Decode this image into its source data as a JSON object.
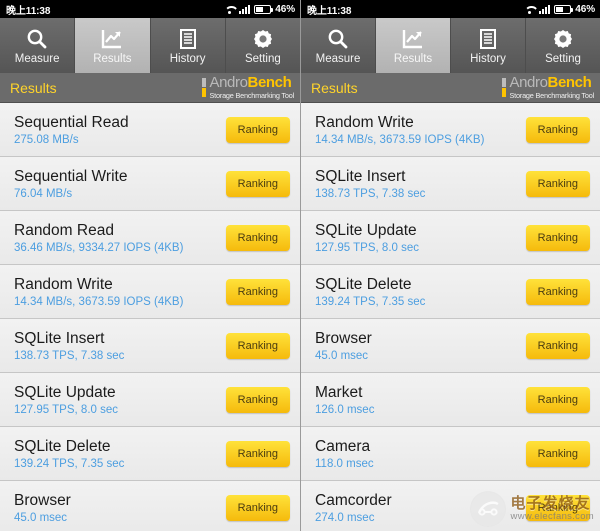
{
  "statusbar": {
    "time": "晚上11:38",
    "battery_percent": "46%",
    "wifi_icon": "wifi-icon",
    "signal_icon": "signal-bars-icon",
    "battery_icon": "battery-icon"
  },
  "tabs": [
    {
      "label": "Measure",
      "icon": "search-icon",
      "active": false
    },
    {
      "label": "Results",
      "icon": "chart-icon",
      "active": true
    },
    {
      "label": "History",
      "icon": "document-icon",
      "active": false
    },
    {
      "label": "Setting",
      "icon": "gear-icon",
      "active": false
    }
  ],
  "resultsbar": {
    "title": "Results",
    "logo_name_part1": "Andro",
    "logo_name_part2": "Bench",
    "logo_tagline": "Storage Benchmarking Tool"
  },
  "ranking_label": "Ranking",
  "left_panel": {
    "rows": [
      {
        "title": "Sequential Read",
        "value": "275.08 MB/s"
      },
      {
        "title": "Sequential Write",
        "value": "76.04 MB/s"
      },
      {
        "title": "Random Read",
        "value": "36.46 MB/s, 9334.27 IOPS (4KB)"
      },
      {
        "title": "Random Write",
        "value": "14.34 MB/s, 3673.59 IOPS (4KB)"
      },
      {
        "title": "SQLite Insert",
        "value": "138.73 TPS, 7.38 sec"
      },
      {
        "title": "SQLite Update",
        "value": "127.95 TPS, 8.0 sec"
      },
      {
        "title": "SQLite Delete",
        "value": "139.24 TPS, 7.35 sec"
      },
      {
        "title": "Browser",
        "value": "45.0 msec"
      }
    ]
  },
  "right_panel": {
    "rows": [
      {
        "title": "Random Write",
        "value": "14.34 MB/s, 3673.59 IOPS (4KB)"
      },
      {
        "title": "SQLite Insert",
        "value": "138.73 TPS, 7.38 sec"
      },
      {
        "title": "SQLite Update",
        "value": "127.95 TPS, 8.0 sec"
      },
      {
        "title": "SQLite Delete",
        "value": "139.24 TPS, 7.35 sec"
      },
      {
        "title": "Browser",
        "value": "45.0 msec"
      },
      {
        "title": "Market",
        "value": "126.0 msec"
      },
      {
        "title": "Camera",
        "value": "118.0 msec"
      },
      {
        "title": "Camcorder",
        "value": "274.0 msec"
      }
    ]
  },
  "watermark": {
    "chinese": "电子发烧友",
    "url": "www.elecfans.com"
  },
  "colors": {
    "accent_yellow": "#ffc400",
    "value_blue": "#4c9ee0",
    "tabbar_dark": "#5f5f5f",
    "results_bar": "#6b6b6b"
  }
}
